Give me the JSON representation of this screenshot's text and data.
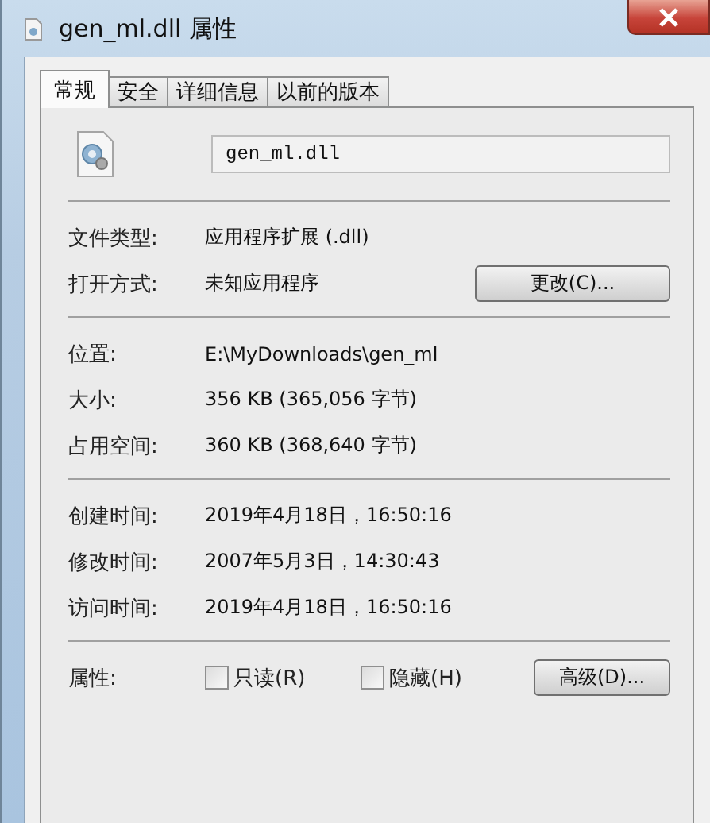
{
  "window": {
    "title": "gen_ml.dll 属性"
  },
  "tabs": [
    {
      "label": "常规",
      "selected": true
    },
    {
      "label": "安全",
      "selected": false
    },
    {
      "label": "详细信息",
      "selected": false
    },
    {
      "label": "以前的版本",
      "selected": false
    }
  ],
  "file_name": {
    "value": "gen_ml.dll"
  },
  "sections": [
    [
      {
        "label": "文件类型:",
        "value": "应用程序扩展 (.dll)"
      },
      {
        "label": "打开方式:",
        "value": "未知应用程序",
        "button": "更改(C)..."
      }
    ],
    [
      {
        "label": "位置:",
        "value": "E:\\MyDownloads\\gen_ml"
      },
      {
        "label": "大小:",
        "value": "356 KB (365,056 字节)"
      },
      {
        "label": "占用空间:",
        "value": "360 KB (368,640 字节)"
      }
    ],
    [
      {
        "label": "创建时间:",
        "value": "2019年4月18日，16:50:16"
      },
      {
        "label": "修改时间:",
        "value": "2007年5月3日，14:30:43"
      },
      {
        "label": "访问时间:",
        "value": "2019年4月18日，16:50:16"
      }
    ]
  ],
  "attributes": {
    "label": "属性:",
    "checkboxes": [
      {
        "label": "只读(R)",
        "checked": false
      },
      {
        "label": "隐藏(H)",
        "checked": false
      }
    ],
    "button": "高级(D)..."
  }
}
